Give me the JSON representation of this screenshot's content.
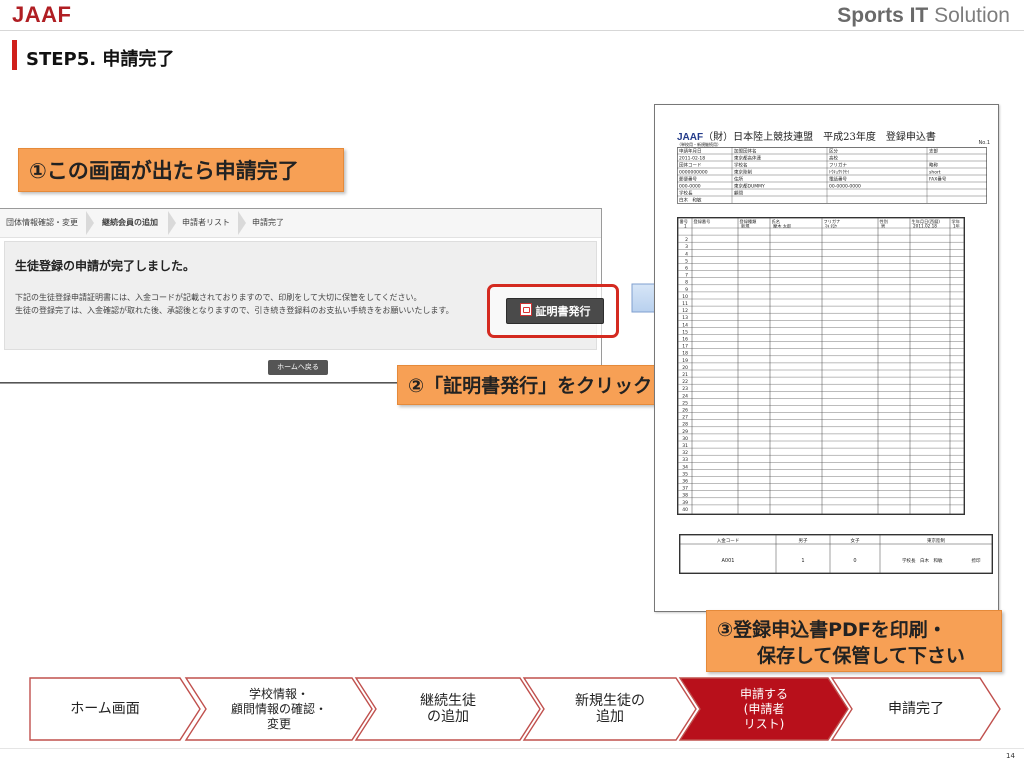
{
  "header": {
    "logo": "JAAF",
    "brand_bold": "Sports IT",
    "brand_light": " Solution"
  },
  "slide_title": "STEP5. 申請完了",
  "callouts": {
    "one": "①この画面が出たら申請完了",
    "two": "②「証明書発行」をクリック",
    "three_line1": "③登録申込書PDFを印刷・",
    "three_line2": "保存して保管して下さい"
  },
  "screen": {
    "breadcrumb": [
      "団体情報確認・変更",
      "継続会員の追加",
      "申請者リスト",
      "申請完了"
    ],
    "heading": "生徒登録の申請が完了しました。",
    "info_line1": "下記の生徒登録申請証明書には、入金コードが記載されておりますので、印刷をして大切に保管をしてください。",
    "info_line2": "生徒の登録完了は、入金確認が取れた後、承認後となりますので、引き続き登録料のお支払い手続きをお願いいたします。",
    "home_button": "ホームへ戻る",
    "cert_button": "証明書発行"
  },
  "document": {
    "org_abbr": "JAAF",
    "title_rest": "（財）日本陸上競技連盟　平成23年度　登録申込書",
    "no": "No.1",
    "sub_label": "（単校用・新規継続用）",
    "header_rows": [
      [
        "申請年月日",
        "加盟団体名",
        "区分",
        "支部"
      ],
      [
        "2011-02-18",
        "東京都高体連",
        "高校",
        ""
      ],
      [
        "団体コード",
        "学校名",
        "フリガナ",
        "略称"
      ],
      [
        "0000000000",
        "東京陸制",
        "ﾄｳｷｮｳﾘｸｾｲ",
        "short"
      ],
      [
        "郵便番号",
        "住所",
        "電話番号",
        "FAX番号"
      ],
      [
        "000-0000",
        "東京都DUMMY",
        "00-0000-0000",
        ""
      ],
      [
        "学校長",
        "顧問",
        "",
        ""
      ],
      [
        "白木　和敏",
        "",
        "",
        ""
      ]
    ],
    "table_headers": [
      "番号",
      "登録番号",
      "登録種類",
      "氏名",
      "フリガナ",
      "性別",
      "生年月日(西暦)",
      "学年"
    ],
    "first_row": [
      "1",
      "",
      "新規",
      "摩木 太郎",
      "ﾏｷ ﾀﾛｳ",
      "男",
      "2011.02.18",
      "1年"
    ],
    "row_count": 40,
    "summary_headers": [
      "入金コード",
      "男子",
      "女子",
      "東京陸制"
    ],
    "summary_values": [
      "A001",
      "1",
      "0",
      "学校長　白木　和敏",
      "捺印"
    ]
  },
  "flow": {
    "steps": [
      {
        "lines": [
          "ホーム画面"
        ]
      },
      {
        "lines": [
          "学校情報・",
          "顧問情報の確認・",
          "変更"
        ]
      },
      {
        "lines": [
          "継続生徒",
          "の追加"
        ]
      },
      {
        "lines": [
          "新規生徒の",
          "追加"
        ]
      },
      {
        "lines": [
          "申請する",
          "(申請者",
          "リスト)"
        ]
      },
      {
        "lines": [
          "申請完了"
        ]
      }
    ],
    "active_index": 4,
    "active_color": "#b8101b",
    "border_color": "#c0504d"
  },
  "page_number": "14",
  "colors": {
    "accent": "#d0201b",
    "callout": "#f7a055",
    "logo": "#b01e23"
  }
}
